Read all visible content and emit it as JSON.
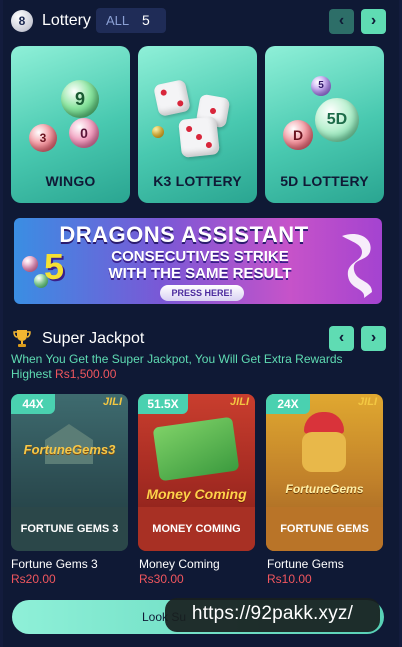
{
  "lottery": {
    "badge": "8",
    "title": "Lottery",
    "all_label": "ALL",
    "all_count": "5",
    "prev_icon": "‹",
    "next_icon": "›",
    "cards": [
      {
        "label": "WINGO",
        "balls": [
          "9",
          "3",
          "0"
        ]
      },
      {
        "label": "K3 LOTTERY"
      },
      {
        "label": "5D LOTTERY",
        "balls": [
          "5",
          "D",
          "5D"
        ]
      }
    ]
  },
  "banner": {
    "title": "DRAGONS ASSISTANT",
    "number": "5",
    "line1": "CONSECUTIVES STRIKE",
    "line2": "WITH THE SAME RESULT",
    "button": "PRESS HERE!"
  },
  "jackpot": {
    "title": "Super Jackpot",
    "description": "When You Get the Super Jackpot, You Will Get Extra Rewards",
    "highest_label": "Highest",
    "highest_amount": "Rs1,500.00",
    "prev_icon": "‹",
    "next_icon": "›",
    "games": [
      {
        "multiplier": "44X",
        "brand": "JILI",
        "art_title": "FortuneGems3",
        "caption": "FORTUNE GEMS 3",
        "name": "Fortune Gems 3",
        "price": "Rs20.00"
      },
      {
        "multiplier": "51.5X",
        "brand": "JILI",
        "art_title": "Money Coming",
        "caption": "MONEY COMING",
        "name": "Money Coming",
        "price": "Rs30.00"
      },
      {
        "multiplier": "24X",
        "brand": "JILI",
        "art_title": "FortuneGems",
        "caption": "FORTUNE GEMS",
        "name": "Fortune Gems",
        "price": "Rs10.00"
      }
    ]
  },
  "look_more": {
    "label": "Look Su"
  },
  "overlay": {
    "url": "https://92pakk.xyz/"
  },
  "colors": {
    "accent": "#5fdcb3",
    "price": "#f0565e",
    "background": "#0f1935"
  }
}
